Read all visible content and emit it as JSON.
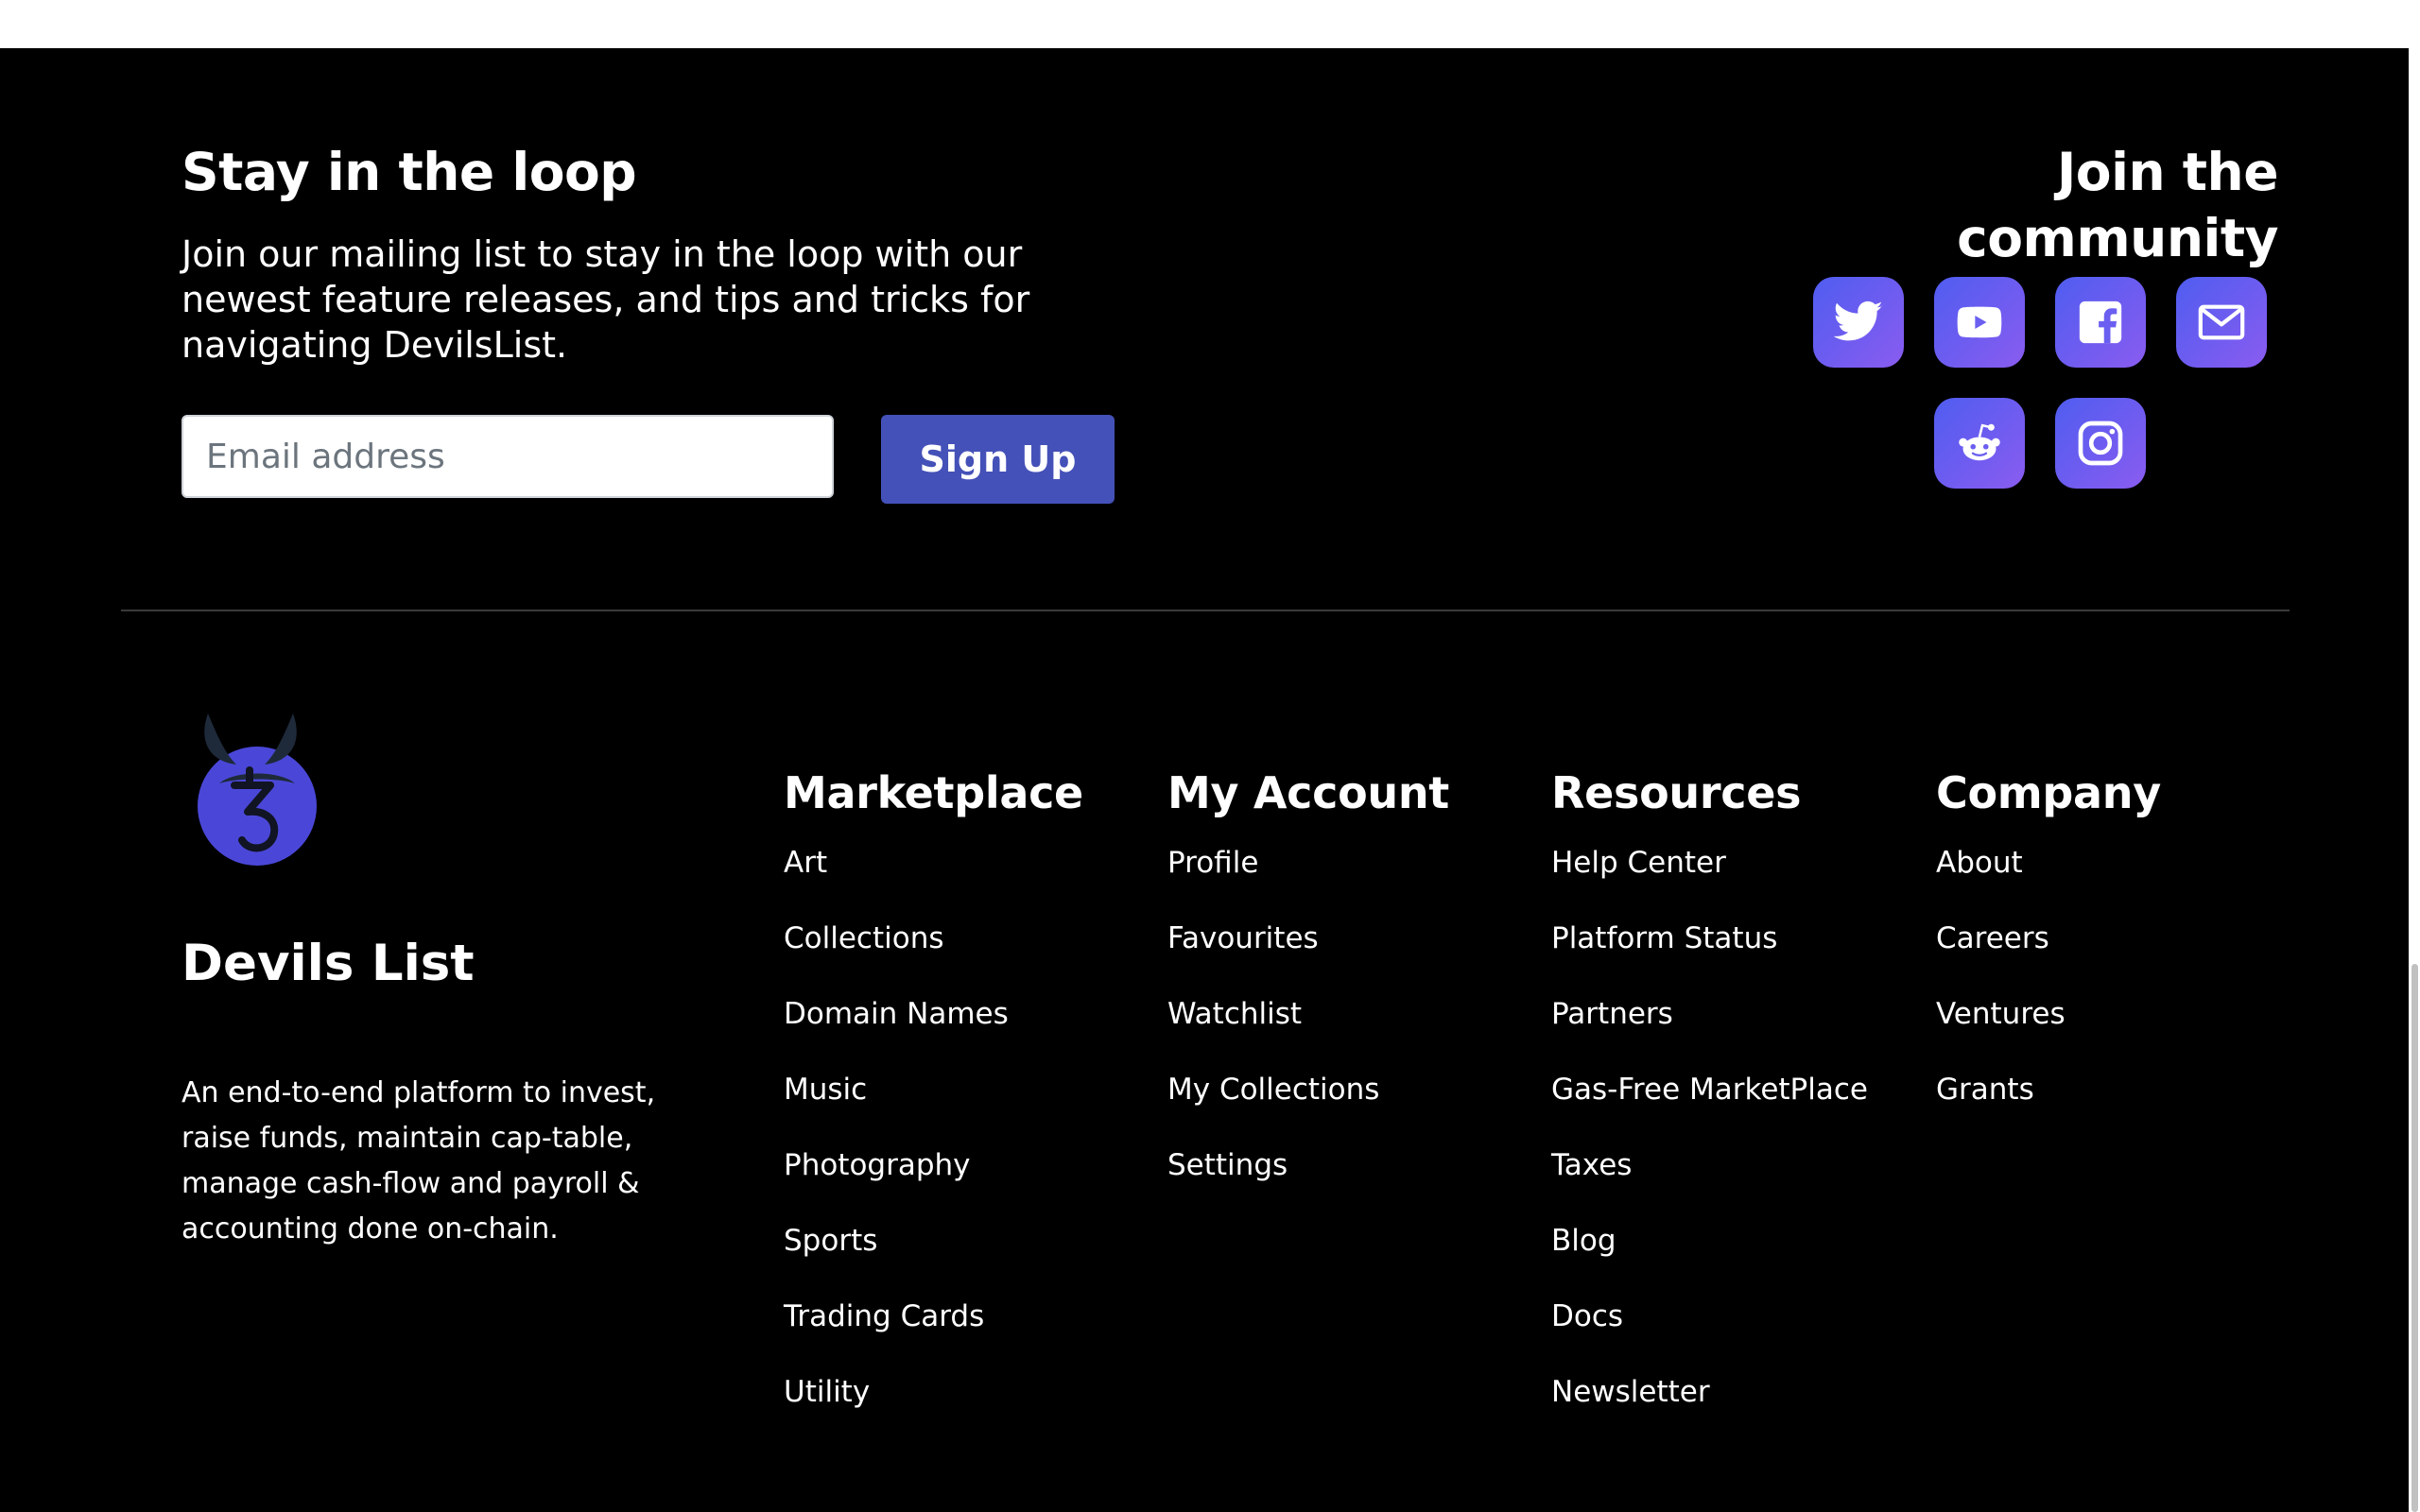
{
  "newsletter": {
    "title": "Stay in the loop",
    "description": "Join our mailing list to stay in the loop with our newest feature releases, and tips and tricks for navigating DevilsList.",
    "email_placeholder": "Email address",
    "signup_label": "Sign Up"
  },
  "community": {
    "title": "Join the community",
    "links": [
      {
        "name": "twitter",
        "icon": "twitter-icon"
      },
      {
        "name": "youtube",
        "icon": "youtube-icon"
      },
      {
        "name": "facebook",
        "icon": "facebook-icon"
      },
      {
        "name": "email",
        "icon": "mail-icon"
      },
      {
        "name": "reddit",
        "icon": "reddit-icon"
      },
      {
        "name": "instagram",
        "icon": "instagram-icon"
      }
    ]
  },
  "brand": {
    "name": "Devils List",
    "description": "An end-to-end platform to invest, raise funds, maintain cap-table, manage cash-flow and payroll & accounting done on-chain.",
    "logo_icon": "devil-tezos-logo"
  },
  "columns": [
    {
      "title": "Marketplace",
      "links": [
        "Art",
        "Collections",
        "Domain Names",
        "Music",
        "Photography",
        "Sports",
        "Trading Cards",
        "Utility"
      ]
    },
    {
      "title": "My Account",
      "links": [
        "Profile",
        "Favourites",
        "Watchlist",
        "My Collections",
        "Settings"
      ]
    },
    {
      "title": "Resources",
      "links": [
        "Help Center",
        "Platform Status",
        "Partners",
        "Gas-Free MarketPlace",
        "Taxes",
        "Blog",
        "Docs",
        "Newsletter"
      ]
    },
    {
      "title": "Company",
      "links": [
        "About",
        "Careers",
        "Ventures",
        "Grants"
      ]
    }
  ],
  "colors": {
    "background": "#000000",
    "accent": "#4451b8",
    "social_gradient_start": "#4f5df0",
    "social_gradient_end": "#8a5cf0",
    "logo": "#4a47d8"
  }
}
